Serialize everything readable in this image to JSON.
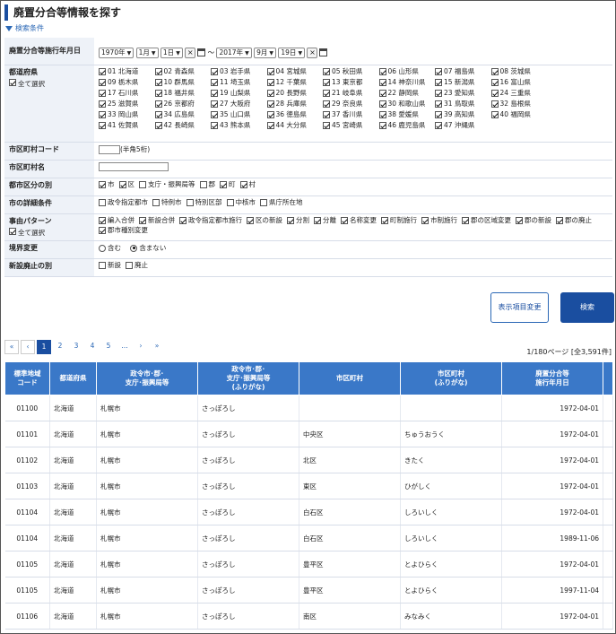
{
  "title": "廃置分合等情報を探す",
  "condition_toggle": "検索条件",
  "form": {
    "date_label": "廃置分合等施行年月日",
    "from": {
      "year": "1970年",
      "month": "1月",
      "day": "1日"
    },
    "tilde": "〜",
    "to": {
      "year": "2017年",
      "month": "9月",
      "day": "19日"
    },
    "pref_label": "都道府県",
    "select_all": "全て選択",
    "prefectures": [
      "01 北海道",
      "02 青森県",
      "03 岩手県",
      "04 宮城県",
      "05 秋田県",
      "06 山形県",
      "07 福島県",
      "08 茨城県",
      "09 栃木県",
      "10 群馬県",
      "11 埼玉県",
      "12 千葉県",
      "13 東京都",
      "14 神奈川県",
      "15 新潟県",
      "16 富山県",
      "17 石川県",
      "18 福井県",
      "19 山梨県",
      "20 長野県",
      "21 岐阜県",
      "22 静岡県",
      "23 愛知県",
      "24 三重県",
      "25 滋賀県",
      "26 京都府",
      "27 大阪府",
      "28 兵庫県",
      "29 奈良県",
      "30 和歌山県",
      "31 鳥取県",
      "32 島根県",
      "33 岡山県",
      "34 広島県",
      "35 山口県",
      "36 徳島県",
      "37 香川県",
      "38 愛媛県",
      "39 高知県",
      "40 福岡県",
      "41 佐賀県",
      "42 長崎県",
      "43 熊本県",
      "44 大分県",
      "45 宮崎県",
      "46 鹿児島県",
      "47 沖縄県"
    ],
    "code_label": "市区町村コード",
    "code_hint": "(半角5桁)",
    "name_label": "市区町村名",
    "type_label": "都市区分の別",
    "types": [
      {
        "label": "市",
        "on": true
      },
      {
        "label": "区",
        "on": true
      },
      {
        "label": "支庁・振興局等",
        "on": false
      },
      {
        "label": "郡",
        "on": false
      },
      {
        "label": "町",
        "on": true
      },
      {
        "label": "村",
        "on": true
      }
    ],
    "detail_label": "市の詳細条件",
    "details": [
      "政令指定都市",
      "特例市",
      "特別区部",
      "中核市",
      "県庁所在地"
    ],
    "reason_label": "事由パターン",
    "reasons": [
      "編入合併",
      "新設合併",
      "政令指定都市施行",
      "区の新設",
      "分割",
      "分離",
      "名称変更",
      "町制施行",
      "市制施行",
      "郡の区域変更",
      "郡の新設",
      "郡の廃止",
      "郡市種別変更"
    ],
    "boundary_label": "境界変更",
    "boundary_opts": [
      "含む",
      "含まない"
    ],
    "newabol_label": "新設廃止の別",
    "newabol_opts": [
      "新設",
      "廃止"
    ]
  },
  "buttons": {
    "columns": "表示項目変更",
    "search": "検索"
  },
  "pager": {
    "first": "«",
    "prev": "‹",
    "pages": [
      "1",
      "2",
      "3",
      "4",
      "5"
    ],
    "ellipsis": "…",
    "next": "›",
    "last": "»"
  },
  "page_info": "1/180ページ [全3,591件]",
  "table": {
    "headers": [
      "標準地域\nコード",
      "都道府県",
      "政令市･郡･\n支庁･振興局等",
      "政令市･郡･\n支庁･振興局等\n(ふりがな)",
      "市区町村",
      "市区町村\n(ふりがな)",
      "廃置分合等\n施行年月日"
    ],
    "rows": [
      [
        "01100",
        "北海道",
        "札幌市",
        "さっぽろし",
        "",
        "",
        "1972-04-01"
      ],
      [
        "01101",
        "北海道",
        "札幌市",
        "さっぽろし",
        "中央区",
        "ちゅうおうく",
        "1972-04-01"
      ],
      [
        "01102",
        "北海道",
        "札幌市",
        "さっぽろし",
        "北区",
        "きたく",
        "1972-04-01"
      ],
      [
        "01103",
        "北海道",
        "札幌市",
        "さっぽろし",
        "東区",
        "ひがしく",
        "1972-04-01"
      ],
      [
        "01104",
        "北海道",
        "札幌市",
        "さっぽろし",
        "白石区",
        "しろいしく",
        "1972-04-01"
      ],
      [
        "01104",
        "北海道",
        "札幌市",
        "さっぽろし",
        "白石区",
        "しろいしく",
        "1989-11-06"
      ],
      [
        "01105",
        "北海道",
        "札幌市",
        "さっぽろし",
        "豊平区",
        "とよひらく",
        "1972-04-01"
      ],
      [
        "01105",
        "北海道",
        "札幌市",
        "さっぽろし",
        "豊平区",
        "とよひらく",
        "1997-11-04"
      ],
      [
        "01106",
        "北海道",
        "札幌市",
        "さっぽろし",
        "南区",
        "みなみく",
        "1972-04-01"
      ]
    ]
  }
}
